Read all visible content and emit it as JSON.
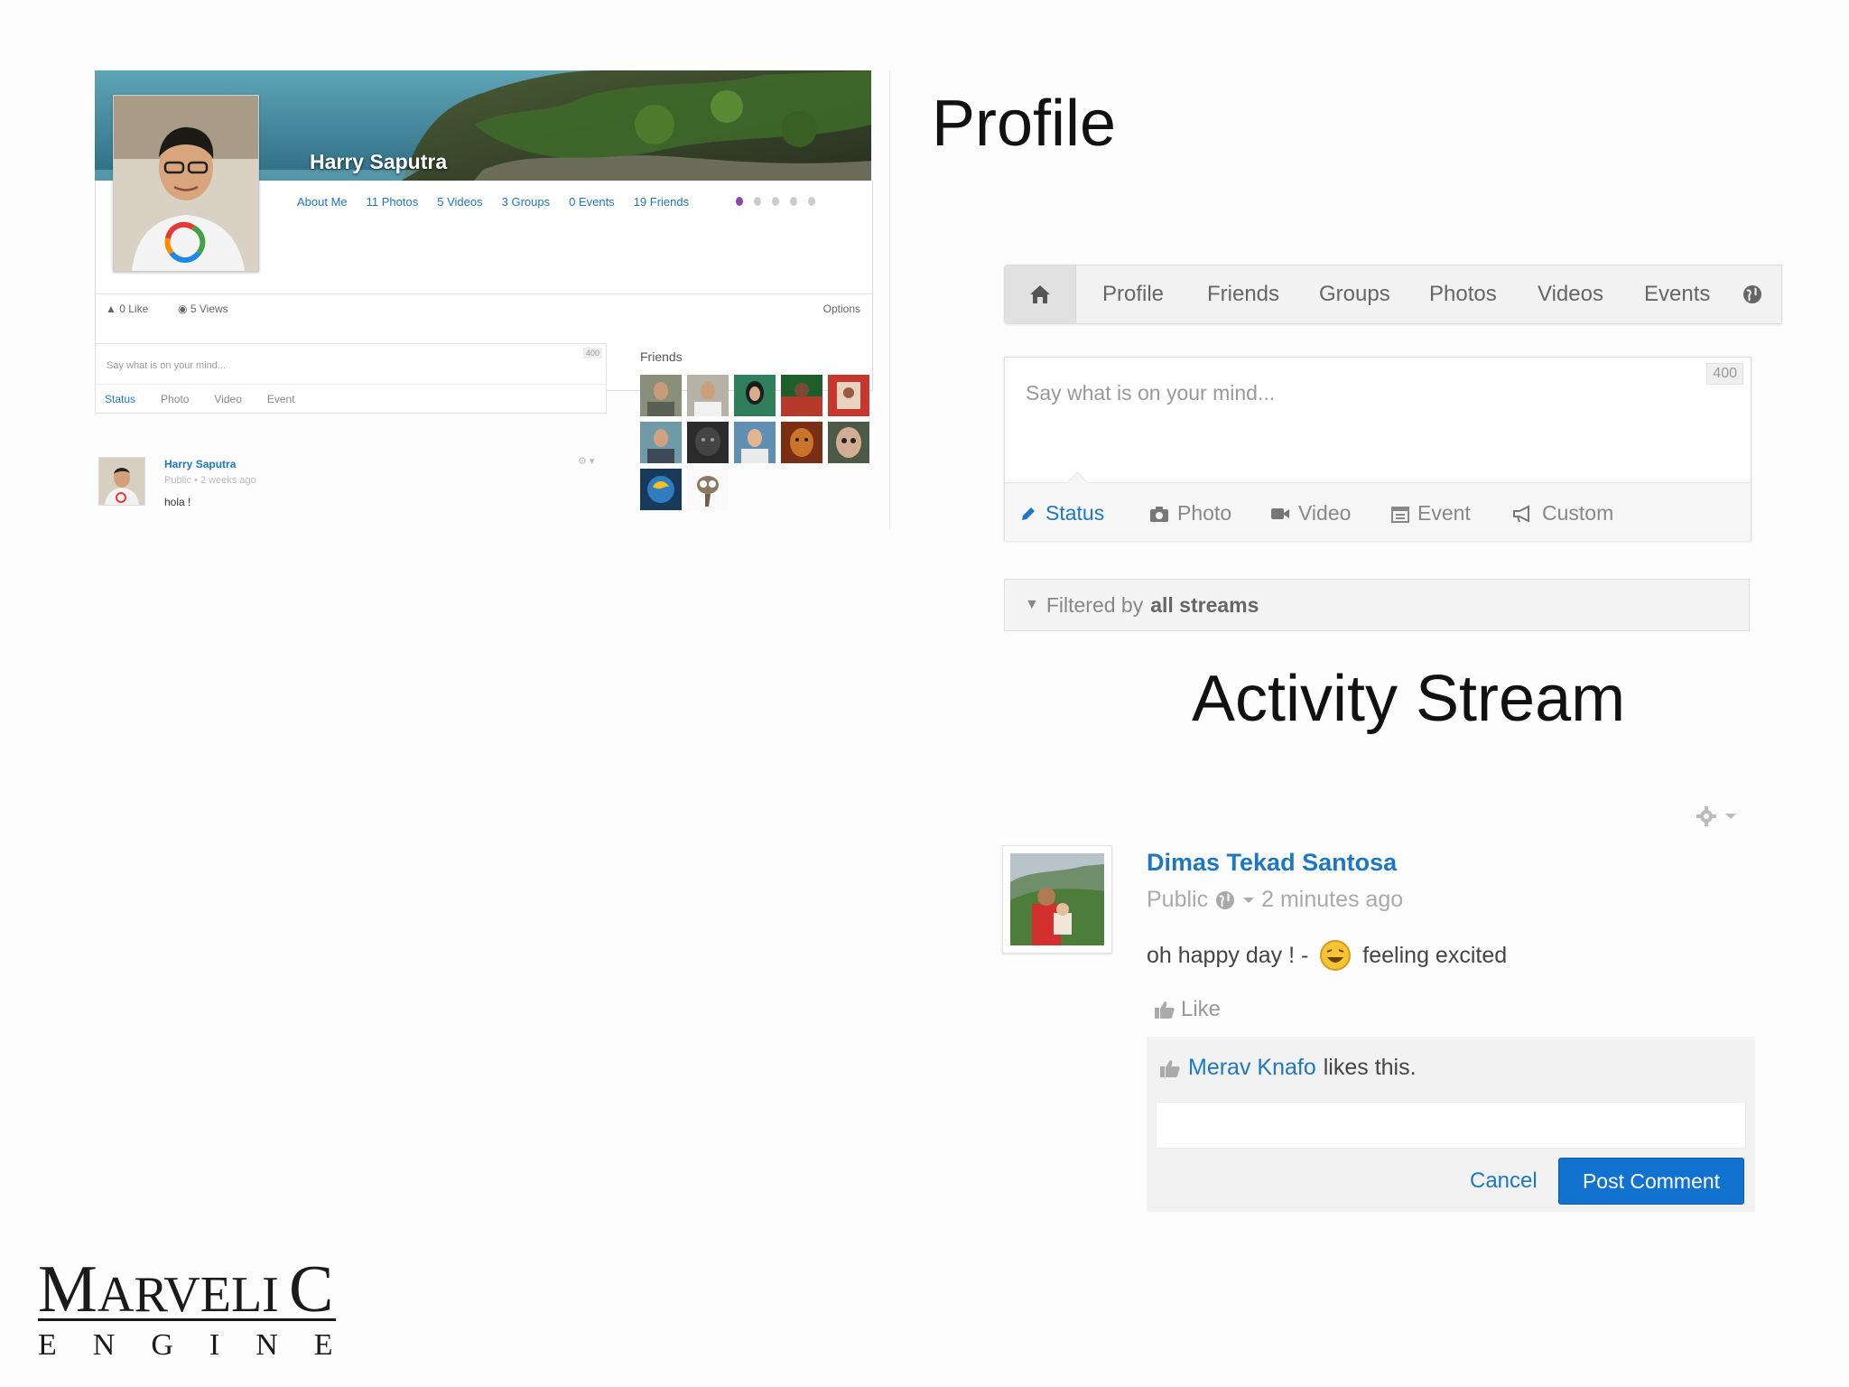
{
  "slide": {
    "profile_title": "Profile",
    "activity_title": "Activity Stream"
  },
  "profile_preview": {
    "user_name": "Harry Saputra",
    "tabs": [
      "About Me",
      "11 Photos",
      "5 Videos",
      "3 Groups",
      "0 Events",
      "19 Friends"
    ],
    "likes": "0 Like",
    "views": "5 Views",
    "options": "Options",
    "share_placeholder": "Say what is on your mind...",
    "share_counter": "400",
    "share_tabs": [
      "Status",
      "Photo",
      "Video",
      "Event"
    ],
    "friends_title": "Friends",
    "post": {
      "author": "Harry Saputra",
      "meta": "Public • 2 weeks ago",
      "text": "hola !"
    }
  },
  "toolbar": {
    "items": [
      "Profile",
      "Friends",
      "Groups",
      "Photos",
      "Videos",
      "Events"
    ]
  },
  "status_box": {
    "placeholder": "Say what is on your mind...",
    "counter": "400",
    "tabs": {
      "status": "Status",
      "photo": "Photo",
      "video": "Video",
      "event": "Event",
      "custom": "Custom"
    }
  },
  "filter": {
    "prefix": "Filtered by",
    "value": "all streams"
  },
  "activity_post": {
    "author": "Dimas Tekad Santosa",
    "privacy": "Public",
    "time": "2 minutes ago",
    "text": "oh happy day ! -",
    "mood": "feeling excited",
    "like_label": "Like",
    "liker": "Merav Knafo",
    "likes_suffix": "likes this.",
    "cancel_label": "Cancel",
    "post_comment_label": "Post Comment"
  },
  "logo": {
    "line1": "MARVELIC",
    "line2": "ENGINE"
  },
  "colors": {
    "link_blue": "#1d78c1",
    "primary_button": "#1272d0"
  }
}
